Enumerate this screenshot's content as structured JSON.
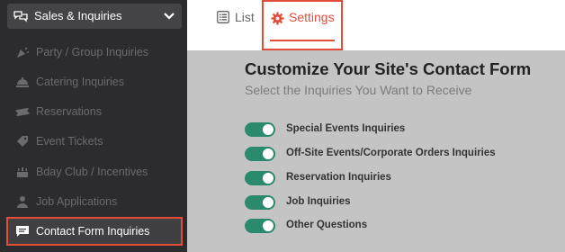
{
  "sidebar": {
    "header": {
      "label": "Sales & Inquiries",
      "icon": "chat-bubbles-icon"
    },
    "items": [
      {
        "label": "Party / Group Inquiries",
        "icon": "party-popper-icon"
      },
      {
        "label": "Catering Inquiries",
        "icon": "cloche-icon"
      },
      {
        "label": "Reservations",
        "icon": "ticket-icon"
      },
      {
        "label": "Event Tickets",
        "icon": "tag-icon"
      },
      {
        "label": "Bday Club / Incentives",
        "icon": "cake-icon"
      },
      {
        "label": "Job Applications",
        "icon": "person-icon"
      },
      {
        "label": "Contact Form Inquiries",
        "icon": "message-icon",
        "active": true
      }
    ]
  },
  "tabs": {
    "list": {
      "label": "List",
      "icon": "list-icon"
    },
    "settings": {
      "label": "Settings",
      "icon": "gear-icon",
      "active": true
    }
  },
  "form": {
    "title": "Customize Your Site's Contact Form",
    "subtitle": "Select the Inquiries You Want to Receive",
    "options": [
      {
        "label": "Special Events Inquiries",
        "enabled": true
      },
      {
        "label": "Off-Site Events/Corporate Orders Inquiries",
        "enabled": true
      },
      {
        "label": "Reservation Inquiries",
        "enabled": true
      },
      {
        "label": "Job Inquiries",
        "enabled": true
      },
      {
        "label": "Other Questions",
        "enabled": true
      }
    ]
  },
  "colors": {
    "accent": "#e24d3a",
    "toggle_on": "#2b8a6e",
    "sidebar_bg": "#2c2c2e"
  }
}
